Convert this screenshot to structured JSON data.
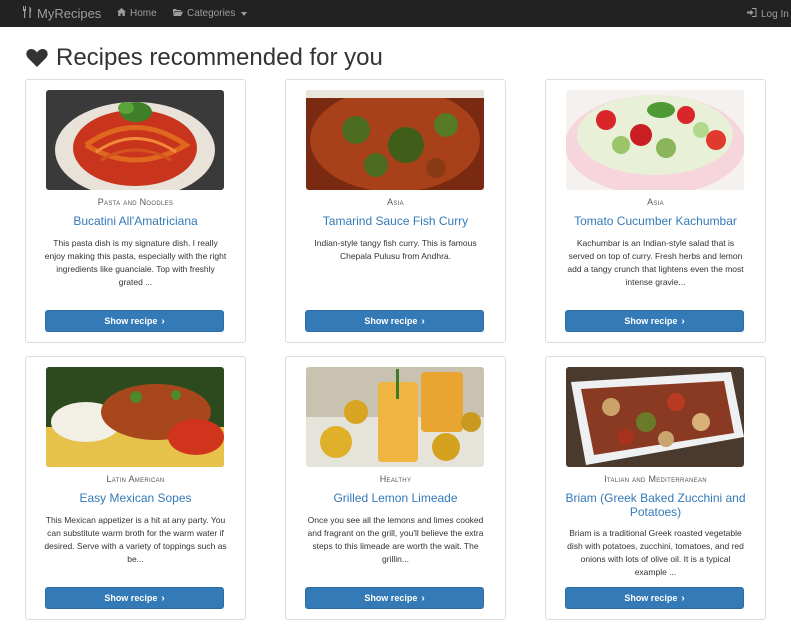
{
  "nav": {
    "brand": "MyRecipes",
    "home": "Home",
    "categories": "Categories",
    "login": "Log In"
  },
  "page_title": "Recipes recommended for you",
  "recipes": [
    {
      "category": "Pasta and Noodles",
      "title": "Bucatini All'Amatriciana",
      "description": "This pasta dish is my signature dish. I really enjoy making this pasta, especially with the right ingredients like guanciale. Top with freshly grated ...",
      "button": "Show recipe"
    },
    {
      "category": "Asia",
      "title": "Tamarind Sauce Fish Curry",
      "description": "Indian-style tangy fish curry. This is famous Chepala Pulusu from Andhra.",
      "button": "Show recipe"
    },
    {
      "category": "Asia",
      "title": "Tomato Cucumber Kachumbar",
      "description": "Kachumbar is an Indian-style salad that is served on top of curry. Fresh herbs and lemon add a tangy crunch that lightens even the most intense gravie...",
      "button": "Show recipe"
    },
    {
      "category": "Latin American",
      "title": "Easy Mexican Sopes",
      "description": "This Mexican appetizer is a hit at any party. You can substitute warm broth for the warm water if desired. Serve with a variety of toppings such as be...",
      "button": "Show recipe"
    },
    {
      "category": "Healthy",
      "title": "Grilled Lemon Limeade",
      "description": "Once you see all the lemons and limes cooked and fragrant on the grill, you'll believe the extra steps to this limeade are worth the wait. The grillin...",
      "button": "Show recipe"
    },
    {
      "category": "Italian and Mediterranean",
      "title": "Briam (Greek Baked Zucchini and Potatoes)",
      "description": "Briam is a traditional Greek roasted vegetable dish with potatoes, zucchini, tomatoes, and red onions with lots of olive oil. It is a typical example ...",
      "button": "Show recipe"
    }
  ]
}
